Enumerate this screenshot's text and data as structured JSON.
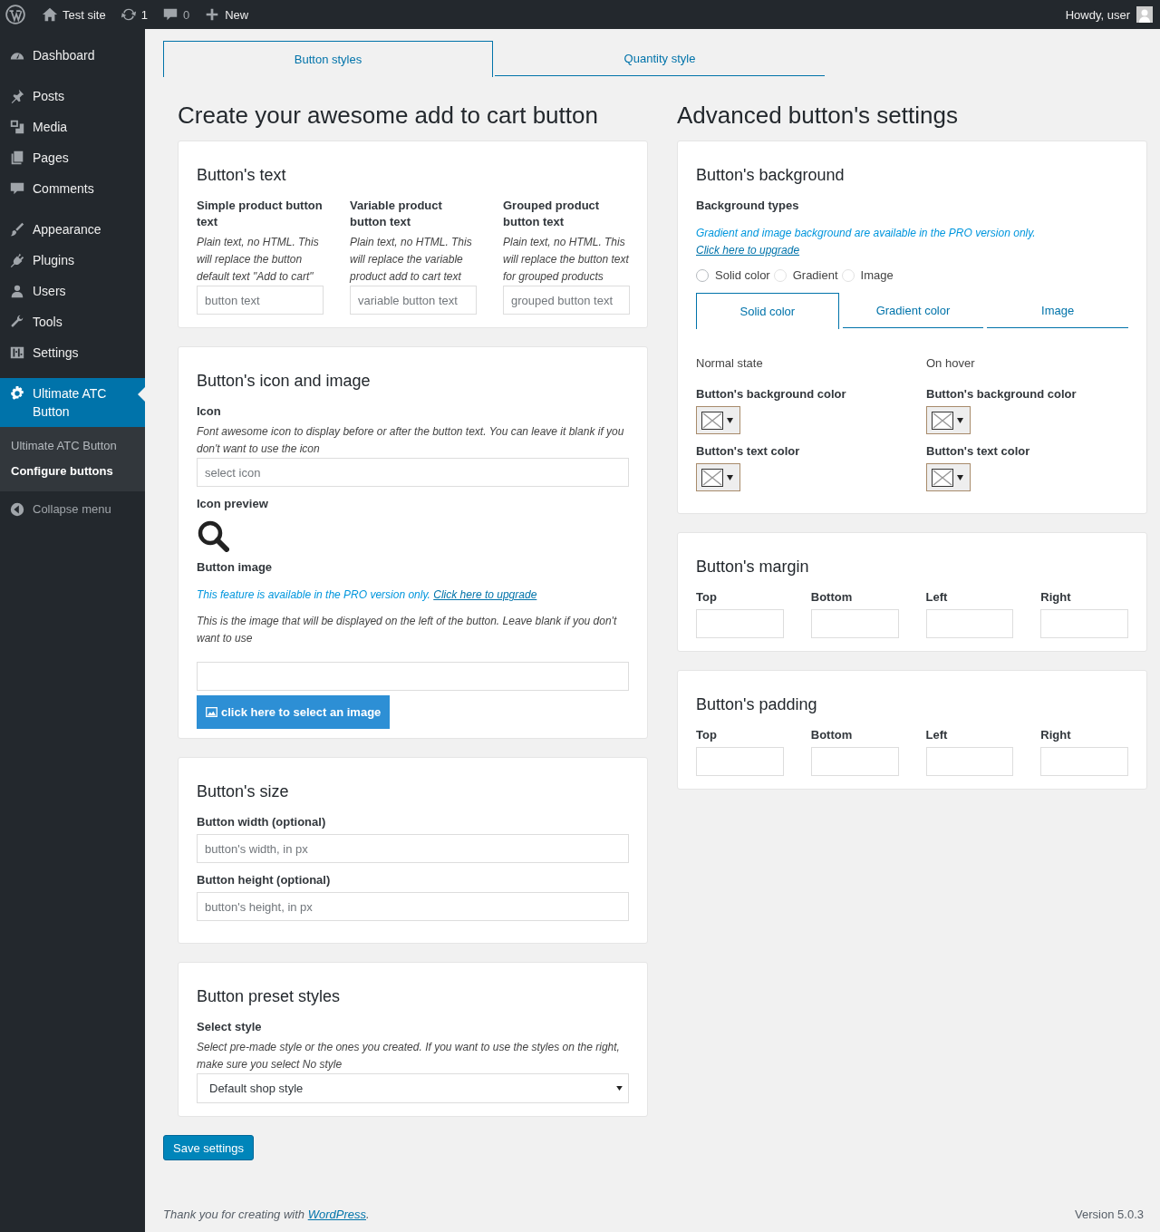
{
  "admin_bar": {
    "site_title": "Test site",
    "updates_count": "1",
    "comments_count": "0",
    "new_label": "New",
    "greeting": "Howdy, user"
  },
  "sidebar": {
    "groups": [
      {
        "items": [
          {
            "label": "Dashboard",
            "selected": false
          }
        ]
      },
      {
        "items": [
          {
            "label": "Posts",
            "selected": false
          },
          {
            "label": "Media",
            "selected": false
          },
          {
            "label": "Pages",
            "selected": false
          },
          {
            "label": "Comments",
            "selected": false
          }
        ]
      },
      {
        "items": [
          {
            "label": "Appearance",
            "selected": false
          },
          {
            "label": "Plugins",
            "selected": false
          },
          {
            "label": "Users",
            "selected": false
          },
          {
            "label": "Tools",
            "selected": false
          },
          {
            "label": "Settings",
            "selected": false
          }
        ]
      },
      {
        "items": [
          {
            "label": "Ultimate ATC Button",
            "selected": true
          }
        ]
      }
    ],
    "submenu": [
      {
        "label": "Ultimate ATC Button",
        "selected": false
      },
      {
        "label": "Configure buttons",
        "selected": true
      }
    ],
    "collapse_label": "Collapse menu"
  },
  "page_tabs": [
    {
      "label": "Button styles",
      "selected": true
    },
    {
      "label": "Quantity style",
      "selected": false
    }
  ],
  "left_title": "Create your awesome add to cart button",
  "right_title": "Advanced button's settings",
  "text_card": {
    "title": "Button's text",
    "fields": [
      {
        "label": "Simple product button text",
        "description": "Plain text, no HTML. This will replace the button default text \"Add to cart\"",
        "placeholder": "button text"
      },
      {
        "label": "Variable product button text",
        "description": "Plain text, no HTML. This will replace the variable product add to cart text",
        "placeholder": "variable button text"
      },
      {
        "label": "Grouped product button text",
        "description": "Plain text, no HTML. This will replace the button text for grouped products",
        "placeholder": "grouped button text"
      }
    ]
  },
  "icon_card": {
    "title": "Button's icon and image",
    "icon_label": "Icon",
    "icon_description": "Font awesome icon to display before or after the button text. You can leave it blank if you don't want to use the icon",
    "icon_placeholder": "select icon",
    "preview_label": "Icon preview",
    "image_label": "Button image",
    "pro_note": {
      "text": "This feature is available in the PRO version only.",
      "link": "Click here to upgrade"
    },
    "image_description": "This is the image that will be displayed on the left of the button. Leave blank if you don't want to use",
    "image_button": "click here to select an image"
  },
  "size_card": {
    "title": "Button's size",
    "fields": [
      {
        "label": "Button width (optional)",
        "placeholder": "button's width, in px"
      },
      {
        "label": "Button height (optional)",
        "placeholder": "button's height, in px"
      }
    ]
  },
  "preset_card": {
    "title": "Button preset styles",
    "label": "Select style",
    "description": "Select pre-made style or the ones you created. If you want to use the styles on the right, make sure you select No style",
    "select_value": "Default shop style"
  },
  "save_button": "Save settings",
  "background_card": {
    "title": "Button's background",
    "types_label": "Background types",
    "pro_note": {
      "text": "Gradient and image background are available in the PRO version only.",
      "link": "Click here to upgrade"
    },
    "radios": [
      {
        "label": "Solid color",
        "selected": false
      },
      {
        "label": "Gradient",
        "selected": false
      },
      {
        "label": "Image",
        "selected": false
      }
    ],
    "tabs": [
      {
        "label": "Solid color",
        "selected": true
      },
      {
        "label": "Gradient color",
        "selected": false
      },
      {
        "label": "Image",
        "selected": false
      }
    ],
    "states": [
      {
        "heading": "Normal state",
        "pickers": [
          {
            "label": "Button's background color"
          },
          {
            "label": "Button's text color"
          }
        ]
      },
      {
        "heading": "On hover",
        "pickers": [
          {
            "label": "Button's background color"
          },
          {
            "label": "Button's text color"
          }
        ]
      }
    ]
  },
  "margin_card": {
    "title": "Button's margin",
    "fields": [
      {
        "label": "Top"
      },
      {
        "label": "Bottom"
      },
      {
        "label": "Left"
      },
      {
        "label": "Right"
      }
    ]
  },
  "padding_card": {
    "title": "Button's padding",
    "fields": [
      {
        "label": "Top"
      },
      {
        "label": "Bottom"
      },
      {
        "label": "Left"
      },
      {
        "label": "Right"
      }
    ]
  },
  "footer": {
    "thanks": "Thank you for creating with",
    "link": "WordPress",
    "after_link": ".",
    "version": "Version 5.0.3"
  }
}
